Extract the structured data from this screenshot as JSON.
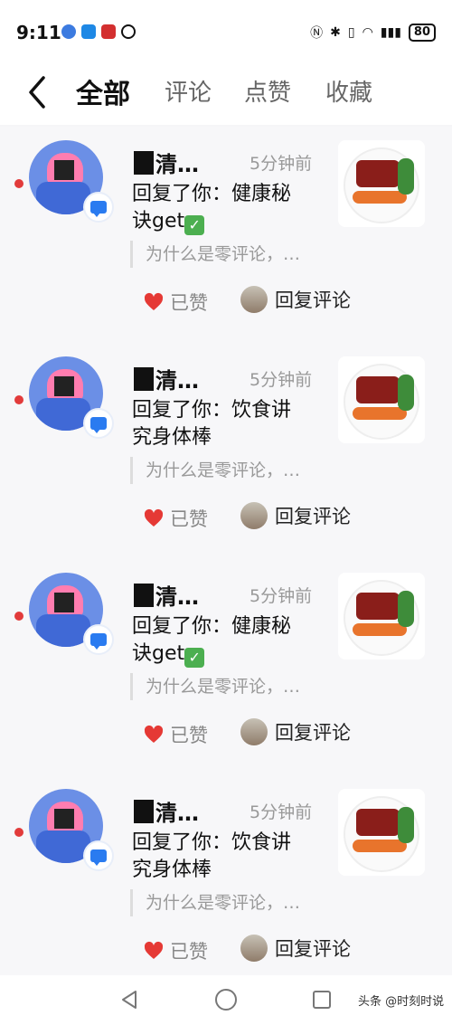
{
  "status_bar": {
    "time": "9:11",
    "battery": "80"
  },
  "header": {
    "tabs": [
      {
        "label": "全部",
        "active": true
      },
      {
        "label": "评论",
        "active": false
      },
      {
        "label": "点赞",
        "active": false
      },
      {
        "label": "收藏",
        "active": false
      }
    ]
  },
  "notifications": [
    {
      "username": "清…",
      "time": "5分钟前",
      "reply_line1": "回复了你：健康秘",
      "reply_line2": "诀get",
      "has_check": true,
      "quote": "为什么是零评论，…",
      "liked_label": "已赞",
      "reply_label": "回复评论"
    },
    {
      "username": "清…",
      "time": "5分钟前",
      "reply_line1": "回复了你：饮食讲",
      "reply_line2": "究身体棒",
      "has_check": false,
      "quote": "为什么是零评论，…",
      "liked_label": "已赞",
      "reply_label": "回复评论"
    },
    {
      "username": "清…",
      "time": "5分钟前",
      "reply_line1": "回复了你：健康秘",
      "reply_line2": "诀get",
      "has_check": true,
      "quote": "为什么是零评论，…",
      "liked_label": "已赞",
      "reply_label": "回复评论"
    },
    {
      "username": "清…",
      "time": "5分钟前",
      "reply_line1": "回复了你：饮食讲",
      "reply_line2": "究身体棒",
      "has_check": false,
      "quote": "为什么是零评论，…",
      "liked_label": "已赞",
      "reply_label": "回复评论"
    }
  ],
  "watermark": "头条 @时刻时说",
  "colors": {
    "like_red": "#e53935",
    "badge_blue": "#2a7bf0",
    "unread_red": "#e23b3b"
  }
}
